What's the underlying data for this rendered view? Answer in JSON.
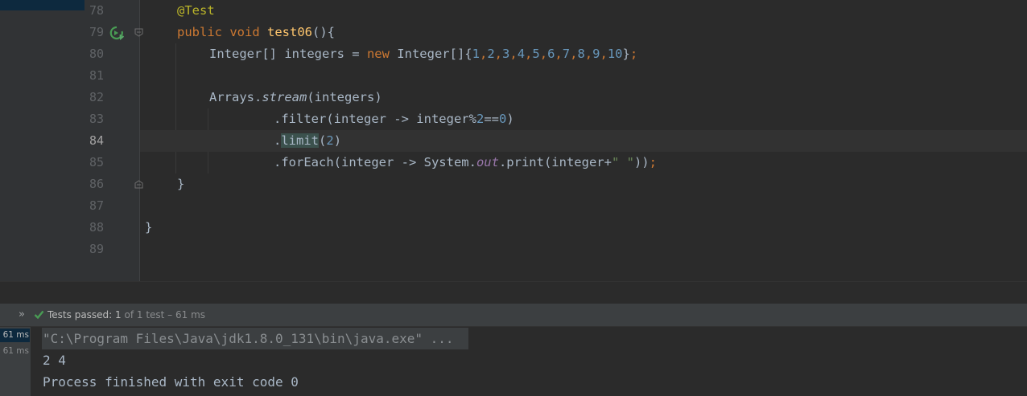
{
  "editor": {
    "line_numbers": [
      "78",
      "79",
      "80",
      "81",
      "82",
      "83",
      "84",
      "85",
      "86",
      "87",
      "88",
      "89"
    ],
    "current_line": "84",
    "code": {
      "l78_annotation": "@Test",
      "l79_public": "public",
      "l79_void": "void",
      "l79_method": "test06",
      "l79_rest": "(){",
      "l80_type": "Integer[] integers = ",
      "l80_new": "new",
      "l80_type2": " Integer[]{",
      "l80_nums": [
        "1",
        "2",
        "3",
        "4",
        "5",
        "6",
        "7",
        "8",
        "9",
        "10"
      ],
      "l80_comma": ",",
      "l80_end": "}",
      "l80_semi": ";",
      "l82_arrays": "Arrays.",
      "l82_stream": "stream",
      "l82_rest": "(integers)",
      "l83_filter": ".filter(integer -> integer%",
      "l83_two": "2",
      "l83_eq": "==",
      "l83_zero": "0",
      "l83_close": ")",
      "l84_dot": ".",
      "l84_limit": "limit",
      "l84_open": "(",
      "l84_two": "2",
      "l84_close": ")",
      "l85_foreach": ".forEach(integer -> System.",
      "l85_out": "out",
      "l85_print": ".print(integer+",
      "l85_str": "\" \"",
      "l85_close": "))",
      "l85_semi": ";",
      "l86_brace": "}",
      "l88_brace": "}"
    }
  },
  "run_panel": {
    "status_label": "Tests passed: ",
    "passed_count": "1",
    "status_rest": " of 1 test – 61 ms",
    "tree_items": [
      "61 ms",
      "61 ms"
    ],
    "console_lines": [
      "\"C:\\Program Files\\Java\\jdk1.8.0_131\\bin\\java.exe\" ...",
      "2 4 ",
      "Process finished with exit code 0"
    ]
  }
}
